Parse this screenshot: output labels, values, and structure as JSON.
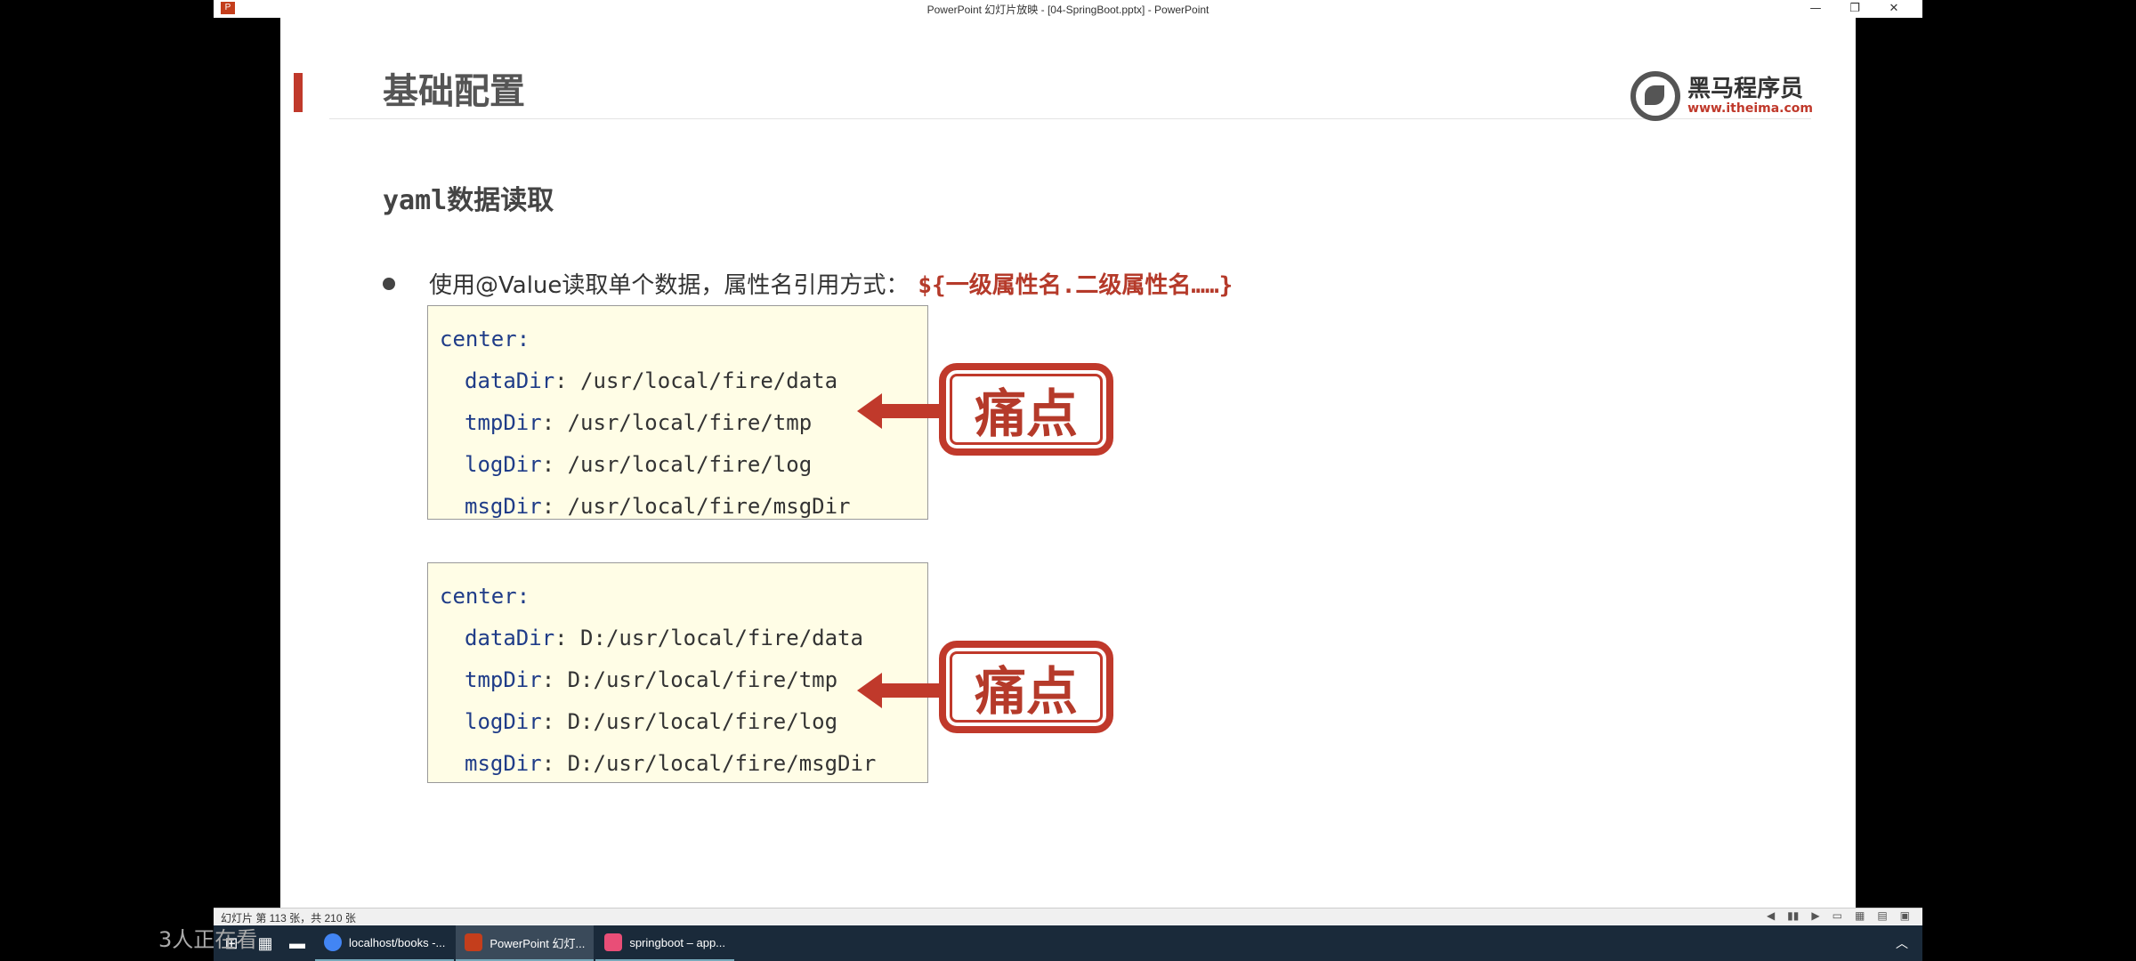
{
  "window": {
    "title": "PowerPoint 幻灯片放映 - [04-SpringBoot.pptx] - PowerPoint",
    "app_icon": "P",
    "minimize": "—",
    "restore": "❐",
    "close": "✕"
  },
  "slide": {
    "watermark": "黑",
    "title": "基础配置",
    "logo": {
      "cn": "黑马程序员",
      "url": "www.itheima.com"
    },
    "subtitle": "yaml数据读取",
    "bullet": {
      "text": "使用@Value读取单个数据，属性名引用方式：",
      "highlight": "${一级属性名.二级属性名……}"
    },
    "code_blocks": [
      {
        "root": "center:",
        "lines": [
          {
            "key": "dataDir",
            "value": ": /usr/local/fire/data"
          },
          {
            "key": "tmpDir",
            "value": ": /usr/local/fire/tmp"
          },
          {
            "key": "logDir",
            "value": ": /usr/local/fire/log"
          },
          {
            "key": "msgDir",
            "value": ": /usr/local/fire/msgDir"
          }
        ]
      },
      {
        "root": "center:",
        "lines": [
          {
            "key": "dataDir",
            "value": ": D:/usr/local/fire/data"
          },
          {
            "key": "tmpDir",
            "value": ": D:/usr/local/fire/tmp"
          },
          {
            "key": "logDir",
            "value": ": D:/usr/local/fire/log"
          },
          {
            "key": "msgDir",
            "value": ": D:/usr/local/fire/msgDir"
          }
        ]
      }
    ],
    "callouts": [
      "痛点",
      "痛点"
    ],
    "progress": 0.54
  },
  "statusbar": {
    "slide_count": "幻灯片 第 113 张，共 210 张"
  },
  "taskbar": {
    "apps": [
      {
        "label": "localhost/books -...",
        "color": "#4285f4"
      },
      {
        "label": "PowerPoint 幻灯...",
        "color": "#c43e1c"
      },
      {
        "label": "springboot – app...",
        "color": "#e94e77"
      }
    ],
    "viewers": "3人正在看"
  },
  "colors": {
    "accent": "#c0392b",
    "code_bg": "#fffde6",
    "key_color": "#1f3c88"
  }
}
